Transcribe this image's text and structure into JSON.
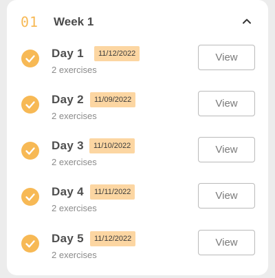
{
  "week": {
    "number": "01",
    "title": "Week 1",
    "toggle_icon": "chevron-up-icon"
  },
  "days": [
    {
      "label": "Day 1",
      "date": "11/12/2022",
      "subtitle": "2 exercises",
      "status_icon": "check-circle-icon",
      "action_label": "View"
    },
    {
      "label": "Day 2",
      "date": "11/09/2022",
      "subtitle": "2 exercises",
      "status_icon": "check-circle-icon",
      "action_label": "View"
    },
    {
      "label": "Day 3",
      "date": "11/10/2022",
      "subtitle": "2 exercises",
      "status_icon": "check-circle-icon",
      "action_label": "View"
    },
    {
      "label": "Day 4",
      "date": "11/11/2022",
      "subtitle": "2 exercises",
      "status_icon": "check-circle-icon",
      "action_label": "View"
    },
    {
      "label": "Day 5",
      "date": "11/12/2022",
      "subtitle": "2 exercises",
      "status_icon": "check-circle-icon",
      "action_label": "View"
    }
  ],
  "colors": {
    "accent": "#f7b955",
    "badge_bg": "#fcd6a2",
    "card_bg": "#ffffff",
    "page_bg": "#ececec"
  }
}
